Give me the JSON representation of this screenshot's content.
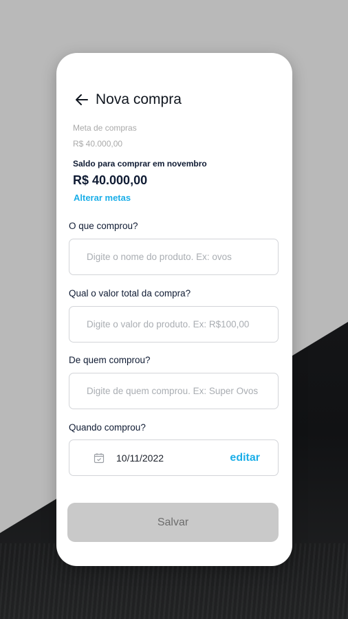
{
  "header": {
    "title": "Nova compra"
  },
  "meta": {
    "label": "Meta de compras",
    "value": "R$ 40.000,00"
  },
  "saldo": {
    "label": "Saldo para comprar em novembro",
    "value": "R$ 40.000,00"
  },
  "alterar_link": "Alterar metas",
  "form": {
    "produto": {
      "label": "O que comprou?",
      "placeholder": "Digite o nome do produto. Ex: ovos"
    },
    "valor": {
      "label": "Qual o valor total da compra?",
      "placeholder": "Digite o valor do produto. Ex: R$100,00"
    },
    "fornecedor": {
      "label": "De quem comprou?",
      "placeholder": "Digite de quem comprou. Ex: Super Ovos"
    },
    "data": {
      "label": "Quando comprou?",
      "value": "10/11/2022",
      "edit_label": "editar"
    }
  },
  "save_label": "Salvar",
  "icons": {
    "back": "arrow-left-icon",
    "calendar": "calendar-icon"
  },
  "colors": {
    "accent": "#1aaee8",
    "text_dark": "#0f1b33",
    "button_disabled": "#c9c9c9"
  }
}
